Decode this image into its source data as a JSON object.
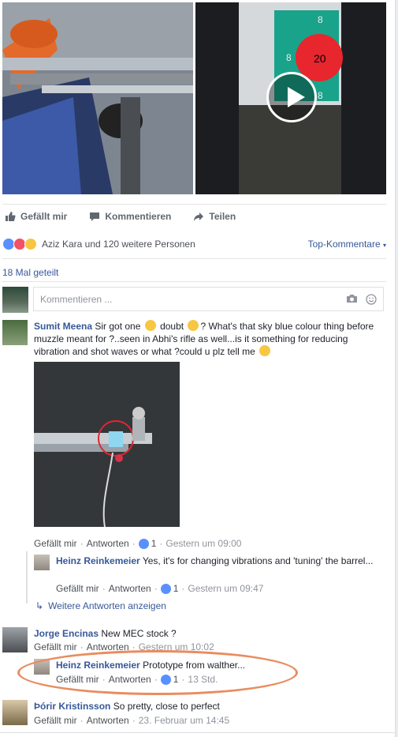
{
  "actions": {
    "like": "Gefällt mir",
    "comment": "Kommentieren",
    "share": "Teilen"
  },
  "reactions": {
    "names": "Aziz Kara und 120 weitere Personen",
    "top_comments": "Top-Kommentare",
    "like_color": "#5890ff",
    "love_color": "#f25268",
    "wow_color": "#f7c744"
  },
  "shares": "18 Mal geteilt",
  "composer": {
    "placeholder": "Kommentieren ..."
  },
  "video_overlay": {
    "score": "20",
    "ring": "8"
  },
  "comments": [
    {
      "author": "Sumit Meena",
      "text_a": "Sir got one ",
      "text_b": " doubt ",
      "text_c": "? What's that sky blue colour thing before muzzle meant for ?..seen in Abhi's rifle as well...is it something for reducing vibration and shot waves or what ?could u plz tell me ",
      "like": "Gefällt mir",
      "reply": "Antworten",
      "likes": "1",
      "time": "Gestern um 09:00",
      "replies": [
        {
          "author": "Heinz Reinkemeier",
          "text": "Yes, it's for changing vibrations and 'tuning' the barrel...",
          "like": "Gefällt mir",
          "reply": "Antworten",
          "likes": "1",
          "time": "Gestern um 09:47"
        }
      ],
      "more_replies": "Weitere Antworten anzeigen"
    },
    {
      "author": "Jorge Encinas",
      "text": "New MEC stock ?",
      "like": "Gefällt mir",
      "reply": "Antworten",
      "time": "Gestern um 10:02",
      "replies": [
        {
          "author": "Heinz Reinkemeier",
          "text": "Prototype from walther...",
          "like": "Gefällt mir",
          "reply": "Antworten",
          "likes": "1",
          "time": "13 Std."
        }
      ]
    },
    {
      "author": "Þórir Kristinsson",
      "text": "So pretty, close to perfect",
      "like": "Gefällt mir",
      "reply": "Antworten",
      "time": "23. Februar um 14:45"
    }
  ]
}
